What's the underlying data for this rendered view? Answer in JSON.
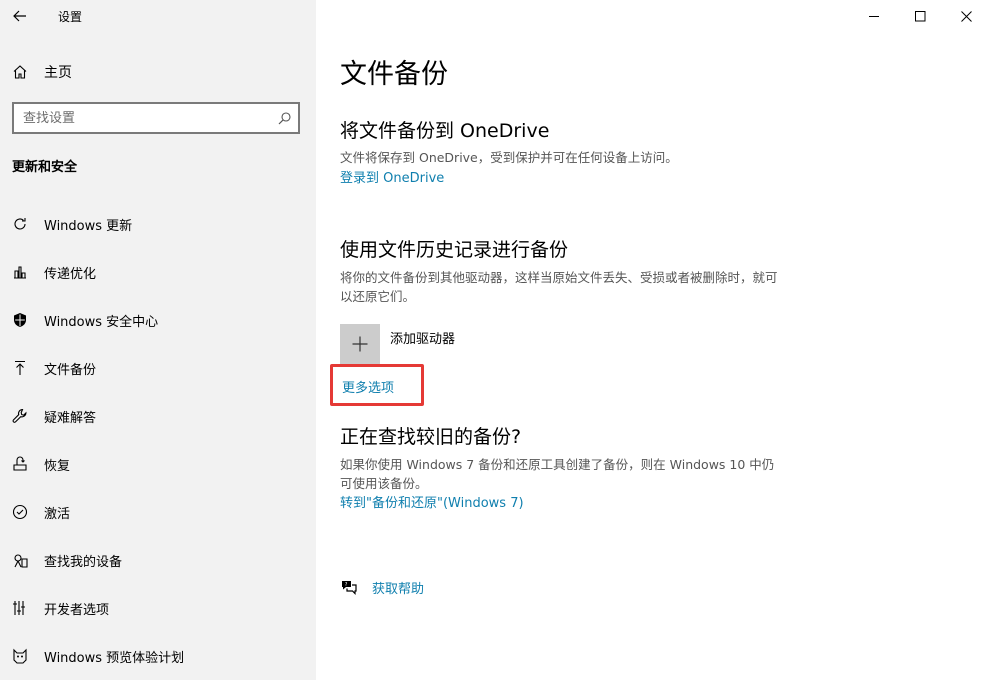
{
  "app_title": "设置",
  "home_label": "主页",
  "search": {
    "placeholder": "查找设置"
  },
  "section_title": "更新和安全",
  "nav": [
    {
      "label": "Windows 更新",
      "icon": "refresh-icon"
    },
    {
      "label": "传递优化",
      "icon": "delivery-optimization-icon"
    },
    {
      "label": "Windows 安全中心",
      "icon": "shield-icon"
    },
    {
      "label": "文件备份",
      "icon": "upload-arrow-icon"
    },
    {
      "label": "疑难解答",
      "icon": "wrench-icon"
    },
    {
      "label": "恢复",
      "icon": "recovery-icon"
    },
    {
      "label": "激活",
      "icon": "check-circle-icon"
    },
    {
      "label": "查找我的设备",
      "icon": "find-device-icon"
    },
    {
      "label": "开发者选项",
      "icon": "developer-icon"
    },
    {
      "label": "Windows 预览体验计划",
      "icon": "insider-cat-icon"
    }
  ],
  "main": {
    "title": "文件备份",
    "onedrive": {
      "heading": "将文件备份到 OneDrive",
      "desc": "文件将保存到 OneDrive，受到保护并可在任何设备上访问。",
      "link": "登录到 OneDrive"
    },
    "history": {
      "heading": "使用文件历史记录进行备份",
      "desc": "将你的文件备份到其他驱动器，这样当原始文件丢失、受损或者被删除时，就可以还原它们。",
      "add_drive": "添加驱动器",
      "more_options": "更多选项"
    },
    "older": {
      "heading": "正在查找较旧的备份?",
      "desc": "如果你使用 Windows 7 备份和还原工具创建了备份，则在 Windows 10 中仍可使用该备份。",
      "link": "转到\"备份和还原\"(Windows 7)"
    },
    "help": "获取帮助"
  },
  "colors": {
    "sidebar_bg": "#f2f2f2",
    "link": "#0f7fae",
    "highlight_border": "#e53935"
  }
}
